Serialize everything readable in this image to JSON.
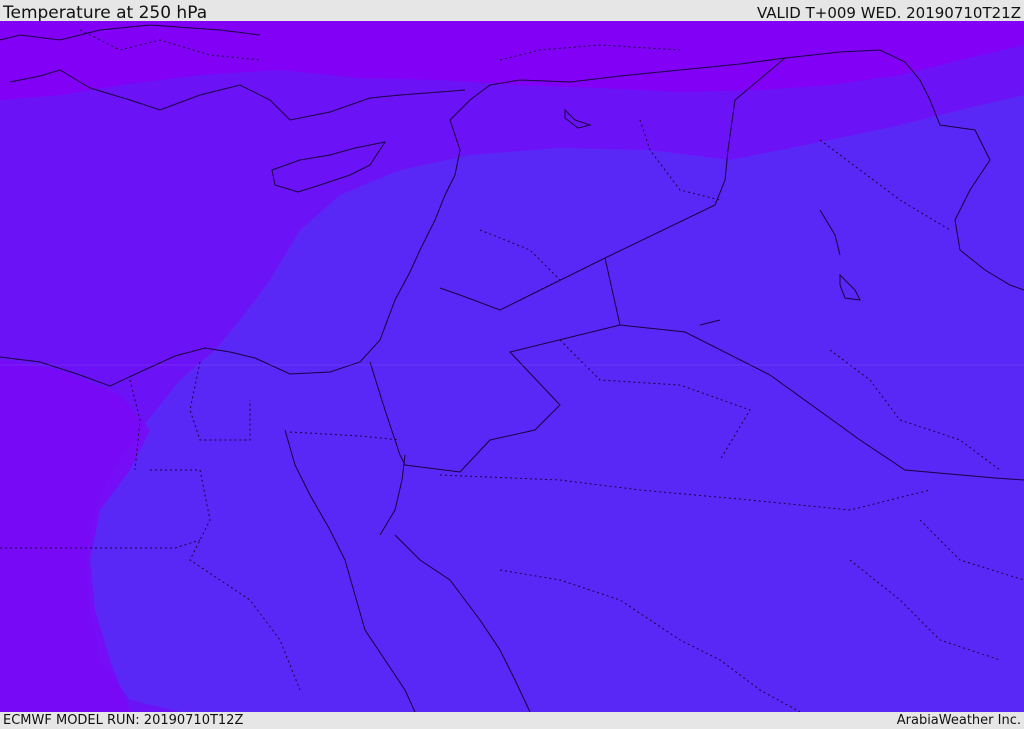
{
  "header": {
    "title": "Temperature at 250 hPa",
    "valid": "VALID T+009 WED. 20190710T21Z"
  },
  "footer": {
    "model_run": "ECMWF MODEL RUN: 20190710T12Z",
    "brand": "ArabiaWeather Inc."
  },
  "colors": {
    "coldest": "#8200f6",
    "cold": "#6c12f6",
    "mid": "#5a28f6",
    "border": "#1a0040"
  }
}
